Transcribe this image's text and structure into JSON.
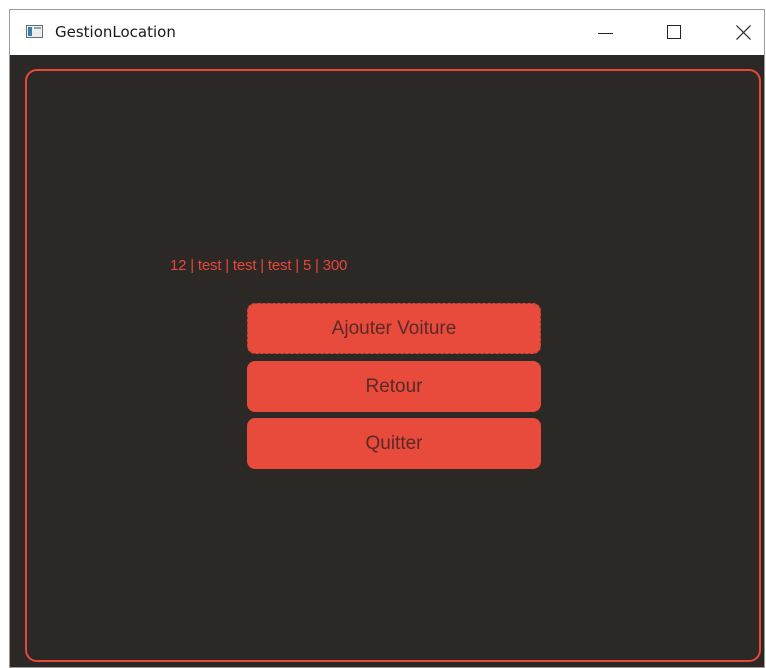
{
  "window": {
    "title": "GestionLocation"
  },
  "content": {
    "info_text": "12 | test | test | test | 5 | 300"
  },
  "buttons": {
    "add_car": "Ajouter Voiture",
    "back": "Retour",
    "quit": "Quitter"
  },
  "colors": {
    "accent": "#e8473b",
    "background": "#2c2826"
  },
  "icons": {
    "app": "app-window-icon",
    "minimize": "minimize-icon",
    "maximize": "maximize-icon",
    "close": "close-icon"
  }
}
